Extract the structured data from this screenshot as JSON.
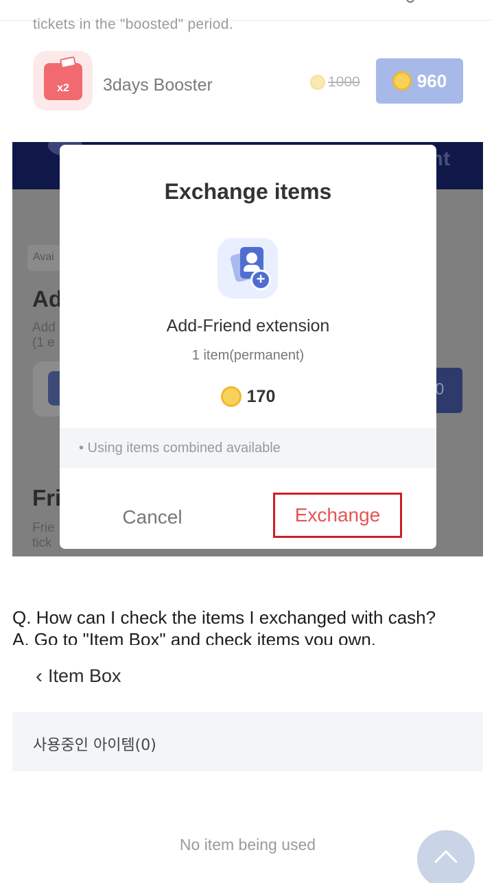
{
  "top": {
    "cut_text": "tickets in the \"boosted\" period."
  },
  "booster": {
    "badge": "x2",
    "name": "3days Booster",
    "old_price": "1000",
    "price": "960"
  },
  "background": {
    "header_text": "nt",
    "available_label": "Avai",
    "heading1": "Ad",
    "sub1_line1": "Add",
    "sub1_line2": "(1 e",
    "button_value": "0",
    "heading2": "Fri",
    "sub2_line1": "Frie",
    "sub2_line2": "tick"
  },
  "dialog": {
    "title": "Exchange items",
    "item_name": "Add-Friend extension",
    "item_qty": "1 item(permanent)",
    "item_price": "170",
    "note": "• Using items combined available",
    "cancel_label": "Cancel",
    "exchange_label": "Exchange"
  },
  "qa": {
    "question": "Q. How can I check the items I exchanged with cash?",
    "answer": "A. Go to \"Item Box\" and check items you own."
  },
  "item_box": {
    "back_icon": "chevron-left-icon",
    "title": "Item Box",
    "section_label": "사용중인 아이템(0)",
    "empty_text": "No item being used"
  },
  "colors": {
    "price_button": "#a7b9e8",
    "exchange_border": "#cc1f25",
    "exchange_text": "#e45454",
    "header_navy": "#0f1849"
  }
}
